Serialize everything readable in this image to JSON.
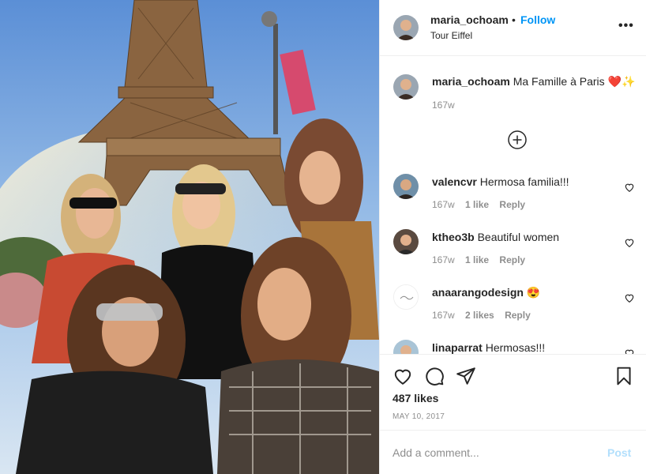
{
  "header": {
    "username": "maria_ochoam",
    "separator": "•",
    "follow_label": "Follow",
    "location": "Tour Eiffel",
    "more_label": "•••"
  },
  "caption": {
    "username": "maria_ochoam",
    "text": "Ma Famille à Paris",
    "emoji": "❤️✨",
    "time": "167w"
  },
  "comments": [
    {
      "username": "valencvr",
      "text": "Hermosa familia!!!",
      "time": "167w",
      "likes": "1 like",
      "reply": "Reply"
    },
    {
      "username": "ktheo3b",
      "text": "Beautiful women",
      "time": "167w",
      "likes": "1 like",
      "reply": "Reply"
    },
    {
      "username": "anaarangodesign",
      "text": "😍",
      "time": "167w",
      "likes": "2 likes",
      "reply": "Reply"
    },
    {
      "username": "linaparrat",
      "text": "Hermosas!!!",
      "time": "",
      "likes": "",
      "reply": ""
    }
  ],
  "post": {
    "likes": "487 likes",
    "date": "MAY 10, 2017"
  },
  "add_comment": {
    "placeholder": "Add a comment...",
    "post_label": "Post"
  },
  "colors": {
    "accent": "#0095f6",
    "post_disabled": "#b2dffc",
    "muted": "#8e8e8e"
  }
}
